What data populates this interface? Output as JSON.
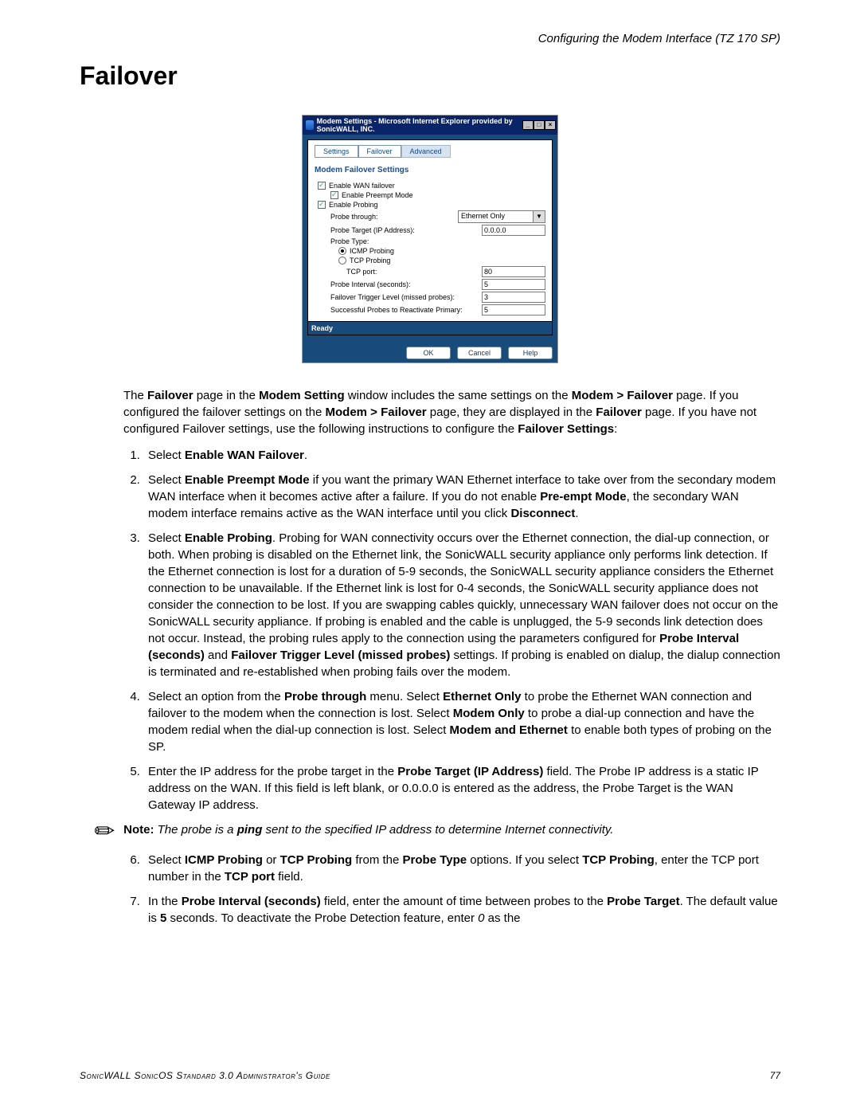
{
  "header_right": "Configuring the Modem Interface (TZ 170 SP)",
  "title": "Failover",
  "screenshot": {
    "window_title": "Modem Settings - Microsoft Internet Explorer provided by SonicWALL, INC.",
    "winbtns": {
      "min": "_",
      "max": "□",
      "close": "×"
    },
    "tabs": {
      "settings": "Settings",
      "failover": "Failover",
      "advanced": "Advanced"
    },
    "section_title": "Modem Failover Settings",
    "rows": {
      "enable_wan": "Enable WAN failover",
      "preempt": "Enable Preempt Mode",
      "enable_probing": "Enable Probing",
      "probe_through_label": "Probe through:",
      "probe_through_value": "Ethernet Only",
      "probe_target_label": "Probe Target (IP Address):",
      "probe_target_value": "0.0.0.0",
      "probe_type_label": "Probe Type:",
      "icmp": "ICMP Probing",
      "tcp": "TCP Probing",
      "tcp_port_label": "TCP port:",
      "tcp_port_value": "80",
      "probe_interval_label": "Probe Interval (seconds):",
      "probe_interval_value": "5",
      "trigger_label": "Failover Trigger Level (missed probes):",
      "trigger_value": "3",
      "reactivate_label": "Successful Probes to Reactivate Primary:",
      "reactivate_value": "5"
    },
    "status": "Ready",
    "buttons": {
      "ok": "OK",
      "cancel": "Cancel",
      "help": "Help"
    }
  },
  "intro": {
    "p1a": "The ",
    "b1": "Failover",
    "p1b": " page in the ",
    "b2": "Modem Setting",
    "p1c": " window includes the same settings on the ",
    "b3": "Modem > Failover",
    "p1d": " page. If you configured the failover settings on the ",
    "b4": "Modem > Failover",
    "p1e": " page, they are displayed in the ",
    "b5": "Failover",
    "p1f": " page. If you have not configured Failover settings, use the following instructions to configure the ",
    "b6": "Failover Settings",
    "p1g": ":"
  },
  "steps": {
    "s1": {
      "a": "Select ",
      "b": "Enable WAN Failover",
      "c": "."
    },
    "s2": {
      "a": "Select ",
      "b": "Enable Preempt Mode",
      "c": " if you want the primary WAN Ethernet interface to take over from the secondary modem WAN interface when it becomes active after a failure. If you do not enable ",
      "d": "Pre-empt Mode",
      "e": ", the secondary WAN modem interface remains active as the WAN interface until you click ",
      "f": "Disconnect",
      "g": "."
    },
    "s3": {
      "a": "Select ",
      "b": "Enable Probing",
      "c": ". Probing for WAN connectivity occurs over the Ethernet connection, the dial-up connection, or both. When probing is disabled on the Ethernet link, the SonicWALL security appliance only performs link detection. If the Ethernet connection is lost for a duration of 5-9 seconds, the SonicWALL security appliance considers the Ethernet connection to be unavailable. If the Ethernet link is lost for 0-4 seconds, the SonicWALL security appliance does not consider the connection to be lost. If you are swapping cables quickly, unnecessary WAN failover does not occur on the SonicWALL security appliance. If probing is enabled and the cable is unplugged, the 5-9 seconds link detection does not occur. Instead, the probing rules apply to the connection using the parameters configured for ",
      "d": "Probe Interval (seconds)",
      "e": " and ",
      "f": "Failover Trigger Level (missed probes)",
      "g": " settings. If probing is enabled on dialup, the dialup connection is terminated and re-established when probing fails over the modem."
    },
    "s4": {
      "a": "Select an option from the ",
      "b": "Probe through",
      "c": " menu. Select ",
      "d": "Ethernet Only",
      "e": " to probe the Ethernet WAN connection and failover to the modem when the connection is lost. Select ",
      "f": "Modem Only",
      "g": " to probe a dial-up connection and have the modem redial when the dial-up connection is lost. Select ",
      "h": "Modem and Ethernet",
      "i": " to enable both types of probing on the SP."
    },
    "s5": {
      "a": "Enter the IP address for the probe target in the ",
      "b": "Probe Target (IP Address)",
      "c": " field. The Probe IP address is a static IP address on the WAN. If this field is left blank, or 0.0.0.0 is entered as the address, the Probe Target is the WAN Gateway IP address."
    },
    "s6": {
      "a": "Select ",
      "b": "ICMP Probing",
      "c": " or ",
      "d": "TCP Probing",
      "e": " from the ",
      "f": "Probe Type",
      "g": " options. If you select ",
      "h": "TCP Probing",
      "i": ", enter the TCP port number in the ",
      "j": "TCP port",
      "k": " field."
    },
    "s7": {
      "a": "In the ",
      "b": "Probe Interval (seconds)",
      "c": " field, enter the amount of time between probes to the ",
      "d": "Probe Target",
      "e": ". The default value is ",
      "f": "5",
      "g": " seconds. To deactivate the Probe Detection feature, enter ",
      "h": "0",
      "i": " as the"
    }
  },
  "note": {
    "label": "Note:",
    "a": "The probe is a ",
    "b": "ping",
    "c": " sent to the specified IP address to determine Internet connectivity."
  },
  "footer": {
    "guide": "SonicWALL SonicOS Standard 3.0 Administrator's Guide",
    "page": "77"
  }
}
